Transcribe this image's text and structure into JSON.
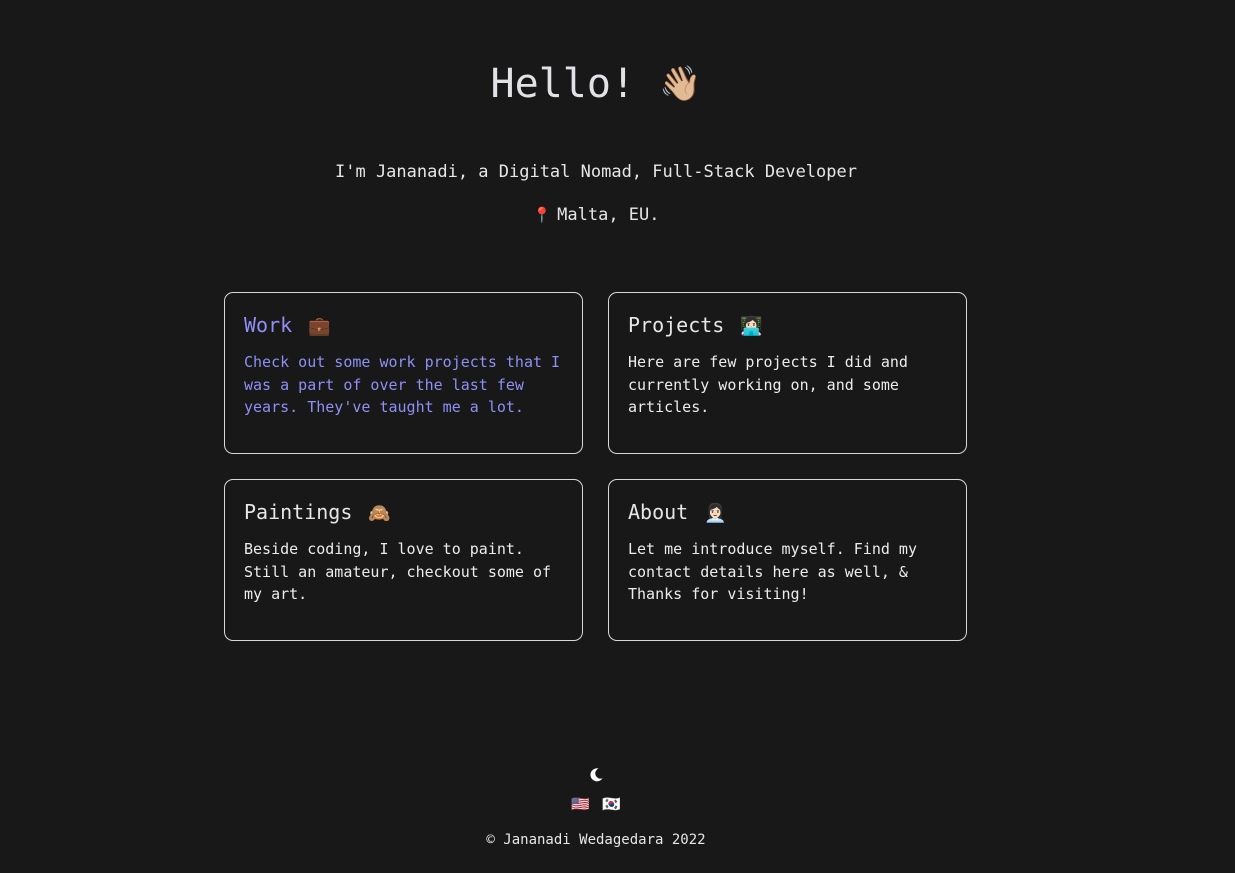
{
  "hero": {
    "greeting": "Hello!",
    "wave_emoji": "👋🏼",
    "tagline": "I'm Jananadi, a Digital Nomad, Full-Stack Developer",
    "location_icon": "📍",
    "location": "Malta, EU."
  },
  "cards": [
    {
      "title": "Work",
      "emoji": "💼",
      "text": "Check out some work projects that I was a part of over the last few years. They've taught me a lot."
    },
    {
      "title": "Projects",
      "emoji": "👩🏻‍💻",
      "text": "Here are few projects I did and currently working on, and some articles."
    },
    {
      "title": "Paintings",
      "emoji": "🙈",
      "text": "Beside coding, I love to paint. Still an amateur, checkout some of my art."
    },
    {
      "title": "About",
      "emoji": "👩🏻‍💼",
      "text": "Let me introduce myself. Find my contact details here as well, & Thanks for visiting!"
    }
  ],
  "footer": {
    "theme_icon": "moon-icon",
    "languages": [
      {
        "flag": "🇺🇸",
        "name": "us-flag"
      },
      {
        "flag": "🇰🇷",
        "name": "kr-flag"
      }
    ],
    "copyright": "© Jananadi Wedagedara 2022"
  },
  "colors": {
    "background": "#181819",
    "text": "#e6e6e8",
    "accent": "#8f8ff5",
    "card_border": "#d8d8dc"
  }
}
